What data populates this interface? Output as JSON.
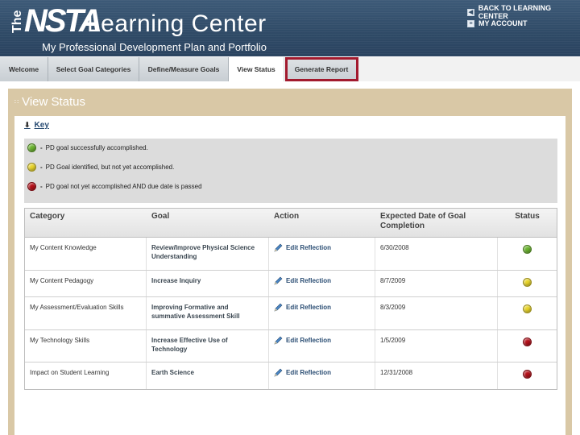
{
  "header": {
    "logo_the": "The",
    "logo_nsta": "NSTA",
    "logo_learning_center": "Learning Center",
    "subtitle": "My Professional Development Plan and Portfolio",
    "links": [
      "BACK TO LEARNING CENTER",
      "MY ACCOUNT"
    ]
  },
  "tabs": [
    {
      "label": "Welcome"
    },
    {
      "label": "Select Goal Categories"
    },
    {
      "label": "Define/Measure Goals"
    },
    {
      "label": "View Status"
    },
    {
      "label": "Generate Report"
    }
  ],
  "active_tab": "View Status",
  "highlighted_tab": "Generate Report",
  "panel": {
    "title": "View Status",
    "key_label": "Key"
  },
  "legend": [
    {
      "color": "green",
      "text": "PD goal successfully accomplished."
    },
    {
      "color": "yellow",
      "text": "PD Goal identified, but not yet accomplished."
    },
    {
      "color": "red",
      "text": "PD goal not yet accomplished AND due date is passed"
    }
  ],
  "table": {
    "headers": [
      "Category",
      "Goal",
      "Action",
      "Expected Date of Goal Completion",
      "Status"
    ],
    "rows": [
      {
        "category": "My Content Knowledge",
        "goal": "Review/Improve Physical Science Understanding",
        "action": "Edit Reflection",
        "date": "6/30/2008",
        "status": "green"
      },
      {
        "category": "My Content Pedagogy",
        "goal": "Increase Inquiry",
        "action": "Edit Reflection",
        "date": "8/7/2009",
        "status": "yellow"
      },
      {
        "category": "My Assessment/Evaluation Skills",
        "goal": "Improving Formative and summative Assessment Skill",
        "action": "Edit Reflection",
        "date": "8/3/2009",
        "status": "yellow"
      },
      {
        "category": "My Technology Skills",
        "goal": "Increase Effective Use of Technology",
        "action": "Edit Reflection",
        "date": "1/5/2009",
        "status": "red"
      },
      {
        "category": "Impact on Student Learning",
        "goal": "Earth Science",
        "action": "Edit Reflection",
        "date": "12/31/2008",
        "status": "red"
      }
    ]
  },
  "colors": {
    "header_bg": "#2f4a66",
    "panel_bg": "#d9c8a6",
    "highlight_border": "#a21a2e",
    "status_green": "#6bb42f",
    "status_yellow": "#e8d42a",
    "status_red": "#b5121b"
  }
}
